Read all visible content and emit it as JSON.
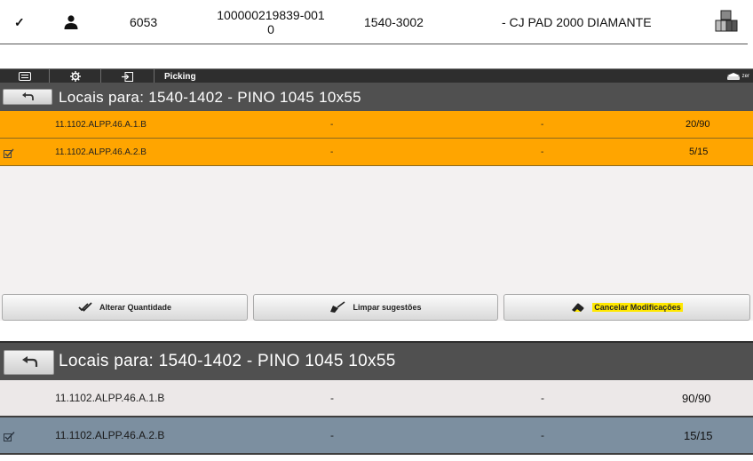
{
  "order": {
    "check_glyph": "✓",
    "number": "6053",
    "id_line1": "100000219839-001",
    "id_line2": "0",
    "product_code": "1540-3002",
    "product_desc": "- CJ PAD 2000 DIAMANTE"
  },
  "toolbar": {
    "title": "Picking",
    "right_text": "zer"
  },
  "panel1": {
    "header": "Locais para: 1540-1402 - PINO 1045 10x55",
    "rows": [
      {
        "checked": false,
        "location": "11.1102.ALPP.46.A.1.B",
        "col2": "-",
        "col3": "-",
        "qty": "20/90"
      },
      {
        "checked": true,
        "location": "11.1102.ALPP.46.A.2.B",
        "col2": "-",
        "col3": "-",
        "qty": "5/15"
      }
    ],
    "buttons": {
      "alter": "Alterar Quantidade",
      "clear": "Limpar sugestões",
      "cancel": "Cancelar Modificações"
    }
  },
  "panel2": {
    "header": "Locais para: 1540-1402 - PINO 1045 10x55",
    "rows": [
      {
        "checked": false,
        "location": "11.1102.ALPP.46.A.1.B",
        "col2": "-",
        "col3": "-",
        "qty": "90/90"
      },
      {
        "checked": true,
        "location": "11.1102.ALPP.46.A.2.B",
        "col2": "-",
        "col3": "-",
        "qty": "15/15"
      }
    ]
  },
  "colors": {
    "orange": "#ffa500",
    "header_gray": "#505050",
    "row_light": "#ece8e8",
    "row_blue": "#7c8fa0",
    "highlight": "#ffe800"
  }
}
